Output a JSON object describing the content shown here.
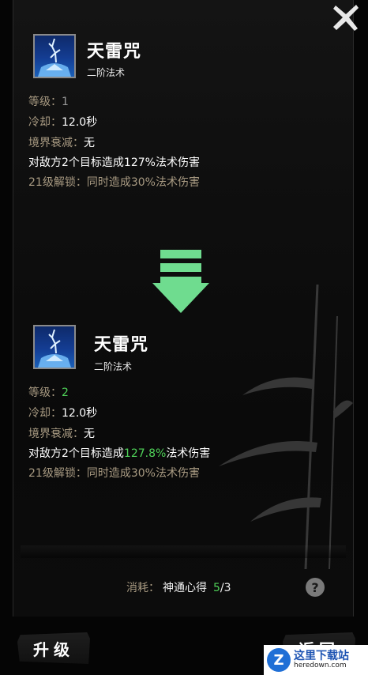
{
  "current": {
    "name": "天雷咒",
    "tier": "二阶法术",
    "level_label": "等级：",
    "level_value": "1",
    "cooldown_label": "冷却：",
    "cooldown_value": "12.0秒",
    "decay_label": "境界衰减：",
    "decay_value": "无",
    "effect_prefix": "对敌方2个目标造成",
    "effect_value": "127%",
    "effect_suffix": "法术伤害",
    "unlock_label": "21级解锁：",
    "unlock_text": "同时造成30%法术伤害"
  },
  "next": {
    "name": "天雷咒",
    "tier": "二阶法术",
    "level_label": "等级：",
    "level_value": "2",
    "cooldown_label": "冷却：",
    "cooldown_value": "12.0秒",
    "decay_label": "境界衰减：",
    "decay_value": "无",
    "effect_prefix": "对敌方2个目标造成",
    "effect_value": "127.8%",
    "effect_suffix": "法术伤害",
    "unlock_label": "21级解锁：",
    "unlock_text": "同时造成30%法术伤害"
  },
  "cost": {
    "label": "消耗：",
    "item": "神通心得",
    "have": "5",
    "need": "/3"
  },
  "buttons": {
    "upgrade": "升级",
    "back": "返回"
  },
  "help_glyph": "?",
  "watermark": {
    "logo_letter": "Z",
    "cn": "这里下载站",
    "en": "heredown.com"
  },
  "colors": {
    "accent_green": "#4fd158",
    "arrow_green": "#6fdc8f",
    "dim_label": "#a89a82"
  },
  "icons": {
    "close": "close-x-icon",
    "skill": "lightning-tree-icon",
    "arrow": "down-arrow-icon",
    "help": "question-icon"
  }
}
